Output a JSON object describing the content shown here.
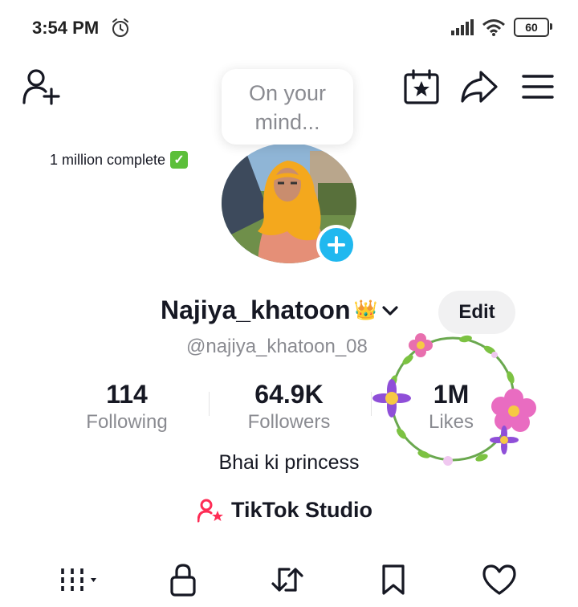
{
  "status_bar": {
    "time": "3:54 PM",
    "battery": "60"
  },
  "header": {
    "bubble_text": "On your mind..."
  },
  "profile": {
    "milestone_text": "1 million complete",
    "display_name": "Najiya_khatoon",
    "crown": "👑",
    "edit_label": "Edit",
    "handle": "@najiya_khatoon_08",
    "bio": "Bhai ki princess",
    "studio_label": "TikTok Studio"
  },
  "stats": [
    {
      "value": "114",
      "label": "Following"
    },
    {
      "value": "64.9K",
      "label": "Followers"
    },
    {
      "value": "1M",
      "label": "Likes"
    }
  ],
  "colors": {
    "accent": "#20b8ef",
    "studio_icon": "#fe2c55",
    "check": "#5cbf3a"
  },
  "tabs": [
    "grid-icon",
    "lock-icon",
    "repost-icon",
    "bookmark-icon",
    "heart-icon"
  ]
}
